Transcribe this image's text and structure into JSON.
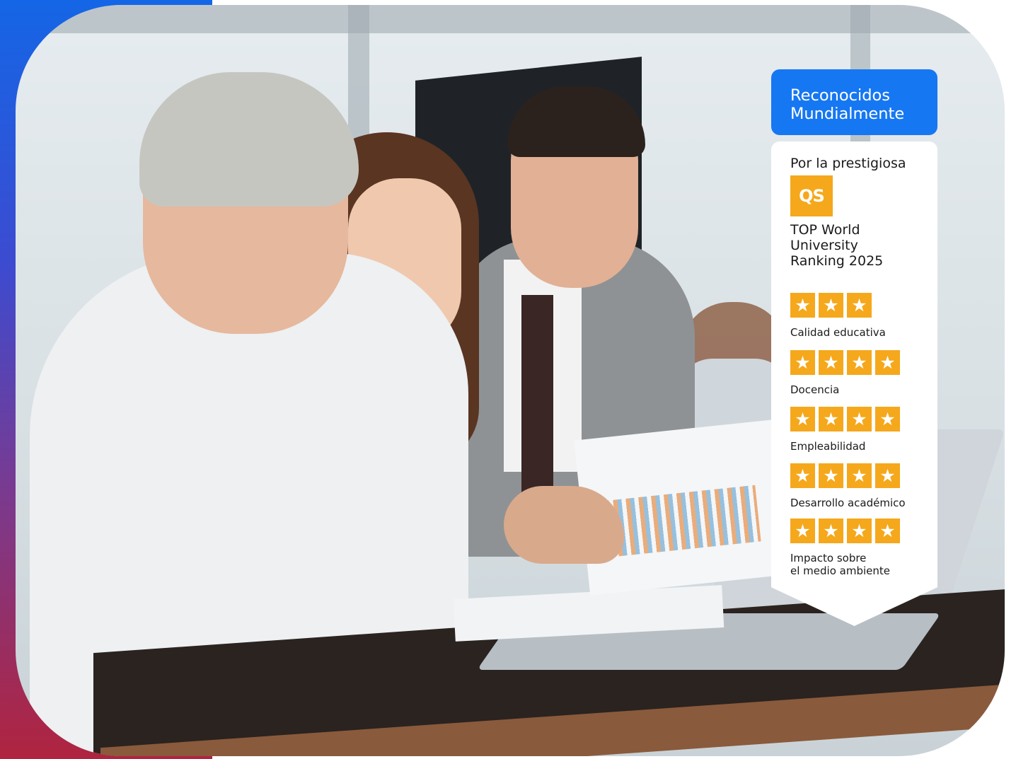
{
  "badge": {
    "header_line1": "Reconocidos",
    "header_line2": "Mundialmente",
    "intro": "Por la prestigiosa",
    "logo_text": "QS",
    "ranking_line1": "TOP World",
    "ranking_line2": "University",
    "ranking_line3": "Ranking 2025",
    "criteria": [
      {
        "label": "Calidad educativa",
        "stars": 3
      },
      {
        "label": "Docencia",
        "stars": 4
      },
      {
        "label": "Empleabilidad",
        "stars": 4
      },
      {
        "label": "Desarrollo académico",
        "stars": 4
      },
      {
        "label_line1": "Impacto sobre",
        "label_line2": "el medio ambiente",
        "stars": 4
      }
    ],
    "star_glyph": "★"
  },
  "colors": {
    "header_bg": "#1677f2",
    "star_bg": "#f5a81c",
    "logo_bg": "#f5a81c",
    "gradient_top": "#1466e6",
    "gradient_bottom": "#b0243f"
  },
  "icons": [
    "qs-logo",
    "star-icon"
  ]
}
